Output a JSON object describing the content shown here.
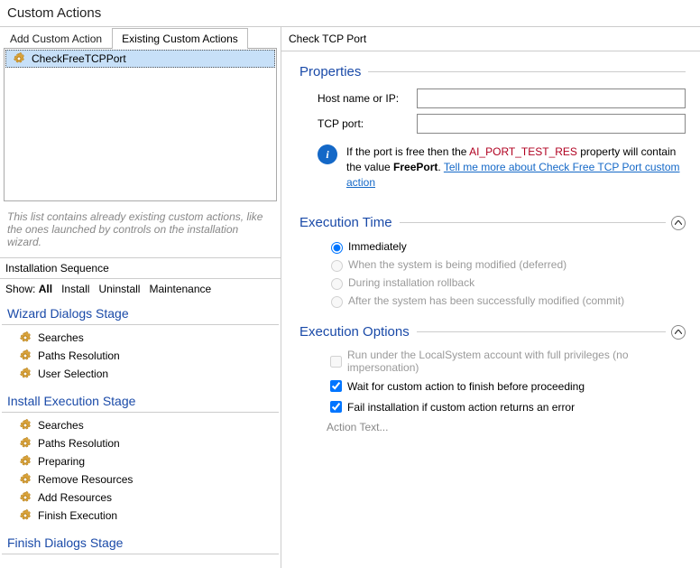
{
  "window_title": "Custom Actions",
  "left": {
    "tabs": {
      "add": "Add Custom Action",
      "existing": "Existing Custom Actions"
    },
    "list": {
      "item0": "CheckFreeTCPPort"
    },
    "list_hint": "This list contains already existing custom actions, like the ones launched by controls on the installation wizard.",
    "seq_header": "Installation Sequence",
    "show": {
      "label": "Show:",
      "all": "All",
      "install": "Install",
      "uninstall": "Uninstall",
      "maintenance": "Maintenance"
    },
    "stage_wizard": "Wizard Dialogs Stage",
    "stage_install": "Install Execution Stage",
    "stage_finish": "Finish Dialogs Stage",
    "items": {
      "searches": "Searches",
      "pathsres": "Paths Resolution",
      "usersel": "User Selection",
      "preparing": "Preparing",
      "removeres": "Remove Resources",
      "addres": "Add Resources",
      "finishexec": "Finish Execution"
    }
  },
  "right": {
    "header": "Check TCP Port",
    "properties": {
      "legend": "Properties",
      "host_label": "Host name or IP:",
      "port_label": "TCP port:",
      "host_value": "",
      "port_value": "",
      "info_prefix": "If the port is free then the ",
      "info_var": "AI_PORT_TEST_RES",
      "info_mid": " property will contain the value ",
      "info_bold": "FreePort",
      "info_dot": ". ",
      "info_link": "Tell me more about Check Free TCP Port custom action"
    },
    "exectime": {
      "legend": "Execution Time",
      "immediately": "Immediately",
      "deferred": "When the system is being modified (deferred)",
      "rollback": "During installation rollback",
      "commit": "After the system has been successfully modified (commit)"
    },
    "execopts": {
      "legend": "Execution Options",
      "localsystem": "Run under the LocalSystem account with full privileges (no impersonation)",
      "wait": "Wait for custom action to finish before proceeding",
      "fail": "Fail installation if custom action returns an error",
      "actiontext": "Action Text..."
    }
  }
}
